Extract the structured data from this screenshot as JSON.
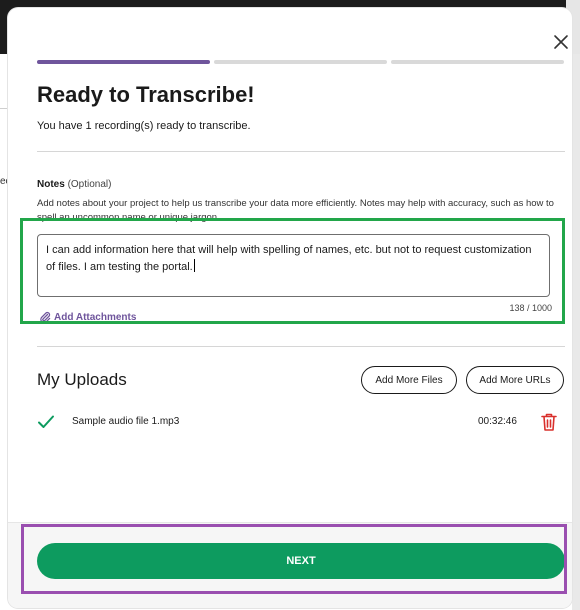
{
  "background": {
    "side_text": "ec"
  },
  "modal": {
    "close_icon": "close-icon",
    "progress": {
      "steps": 3,
      "current_step": 1,
      "active_color": "#6f559c",
      "inactive_color": "#d9d9d9"
    },
    "title": "Ready to Transcribe!",
    "subtitle": "You have 1 recording(s) ready to transcribe."
  },
  "notes": {
    "label": "Notes",
    "optional": "(Optional)",
    "help": "Add notes about your project to help us transcribe your data more efficiently. Notes may help with accuracy, such as how to spell an uncommon name or unique jargon.",
    "value": "I can add information here that will help with spelling of names, etc. but not to request customization of files. I am testing the portal.",
    "char_count": "138 / 1000",
    "attach_label": "Add Attachments",
    "attach_icon": "paperclip-icon"
  },
  "uploads": {
    "title": "My Uploads",
    "add_files_label": "Add More Files",
    "add_urls_label": "Add More URLs",
    "files": [
      {
        "name": "Sample audio file 1.mp3",
        "duration": "00:32:46",
        "status_icon": "check-icon",
        "delete_icon": "trash-icon"
      }
    ]
  },
  "footer": {
    "next_label": "NEXT"
  },
  "colors": {
    "accent_purple": "#6f559c",
    "primary_green": "#0d9b5f",
    "delete_red": "#d9302c",
    "highlight_green": "#22a64a",
    "highlight_purple": "#9a4fb0"
  }
}
